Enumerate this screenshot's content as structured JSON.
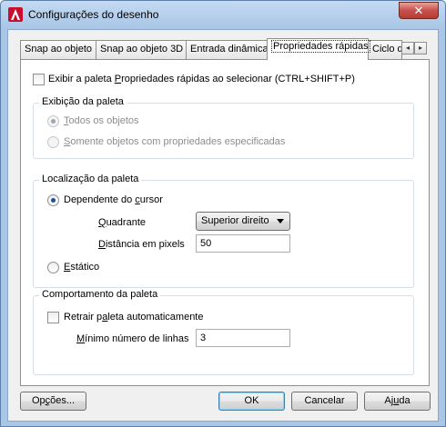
{
  "window": {
    "title": "Configurações do desenho",
    "close_glyph": "✕"
  },
  "tabs": [
    {
      "label": "Snap ao objeto"
    },
    {
      "label": "Snap ao objeto 3D"
    },
    {
      "label": "Entrada dinâmica"
    },
    {
      "label": "Propriedades rápidas",
      "active": true
    },
    {
      "label": "Ciclo d"
    }
  ],
  "tab_scroll": {
    "left_glyph": "◂",
    "right_glyph": "▸"
  },
  "show_palette": {
    "pre": "Exibir a paleta ",
    "key": "P",
    "post": "ropriedades rápidas ao selecionar (CTRL+SHIFT+P)",
    "checked": false
  },
  "display_group": {
    "title": "Exibição da paleta",
    "option_all": {
      "key": "T",
      "rest": "odos os objetos",
      "selected": true,
      "disabled": true
    },
    "option_specified": {
      "key": "S",
      "rest": "omente objetos com propriedades especificadas",
      "selected": false,
      "disabled": true
    }
  },
  "location_group": {
    "title": "Localização da paleta",
    "option_cursor": {
      "pre": "Dependente do ",
      "key": "c",
      "post": "ursor",
      "selected": true
    },
    "quadrant_label": {
      "key": "Q",
      "rest": "uadrante"
    },
    "quadrant_value": "Superior direito",
    "distance_label": {
      "key": "D",
      "rest": "istância em pixels"
    },
    "distance_value": "50",
    "option_static": {
      "key": "E",
      "rest": "stático",
      "selected": false
    }
  },
  "behavior_group": {
    "title": "Comportamento da paleta",
    "auto_collapse": {
      "pre": "Retrair p",
      "key": "a",
      "post": "leta automaticamente",
      "checked": false
    },
    "min_lines_label": {
      "key": "M",
      "rest": "ínimo número de linhas"
    },
    "min_lines_value": "3"
  },
  "buttons": {
    "options": {
      "pre": "Op",
      "key": "ç",
      "post": "ões..."
    },
    "ok": "OK",
    "cancel": "Cancelar",
    "help": {
      "pre": "Aj",
      "key": "u",
      "post": "da"
    }
  }
}
